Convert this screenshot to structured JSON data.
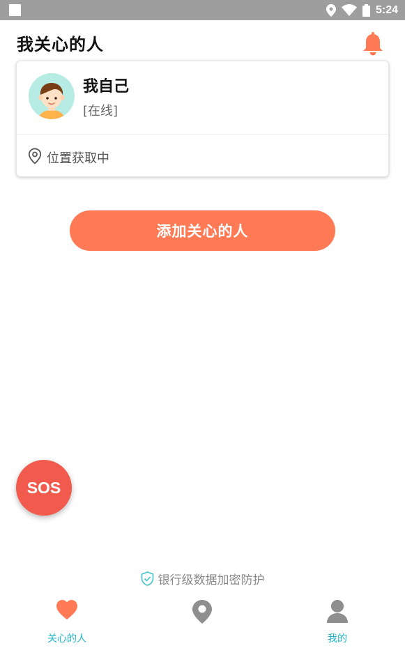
{
  "status_bar": {
    "time": "5:24"
  },
  "header": {
    "title": "我关心的人"
  },
  "card": {
    "name": "我自己",
    "status": "[在线]",
    "location": "位置获取中"
  },
  "add_button": {
    "label": "添加关心的人"
  },
  "sos": {
    "label": "SOS"
  },
  "security_note": {
    "text": "银行级数据加密防护"
  },
  "bottom_nav": {
    "items": [
      {
        "label": "关心的人",
        "icon": "heart-icon",
        "active": true
      },
      {
        "label": "",
        "icon": "map-pin-icon",
        "active": false
      },
      {
        "label": "我的",
        "icon": "person-icon",
        "active": false
      }
    ]
  },
  "colors": {
    "accent": "#ff7a55",
    "sos": "#f25a4d",
    "nav_label": "#1fb6c6",
    "status_bar": "#9e9e9e"
  }
}
